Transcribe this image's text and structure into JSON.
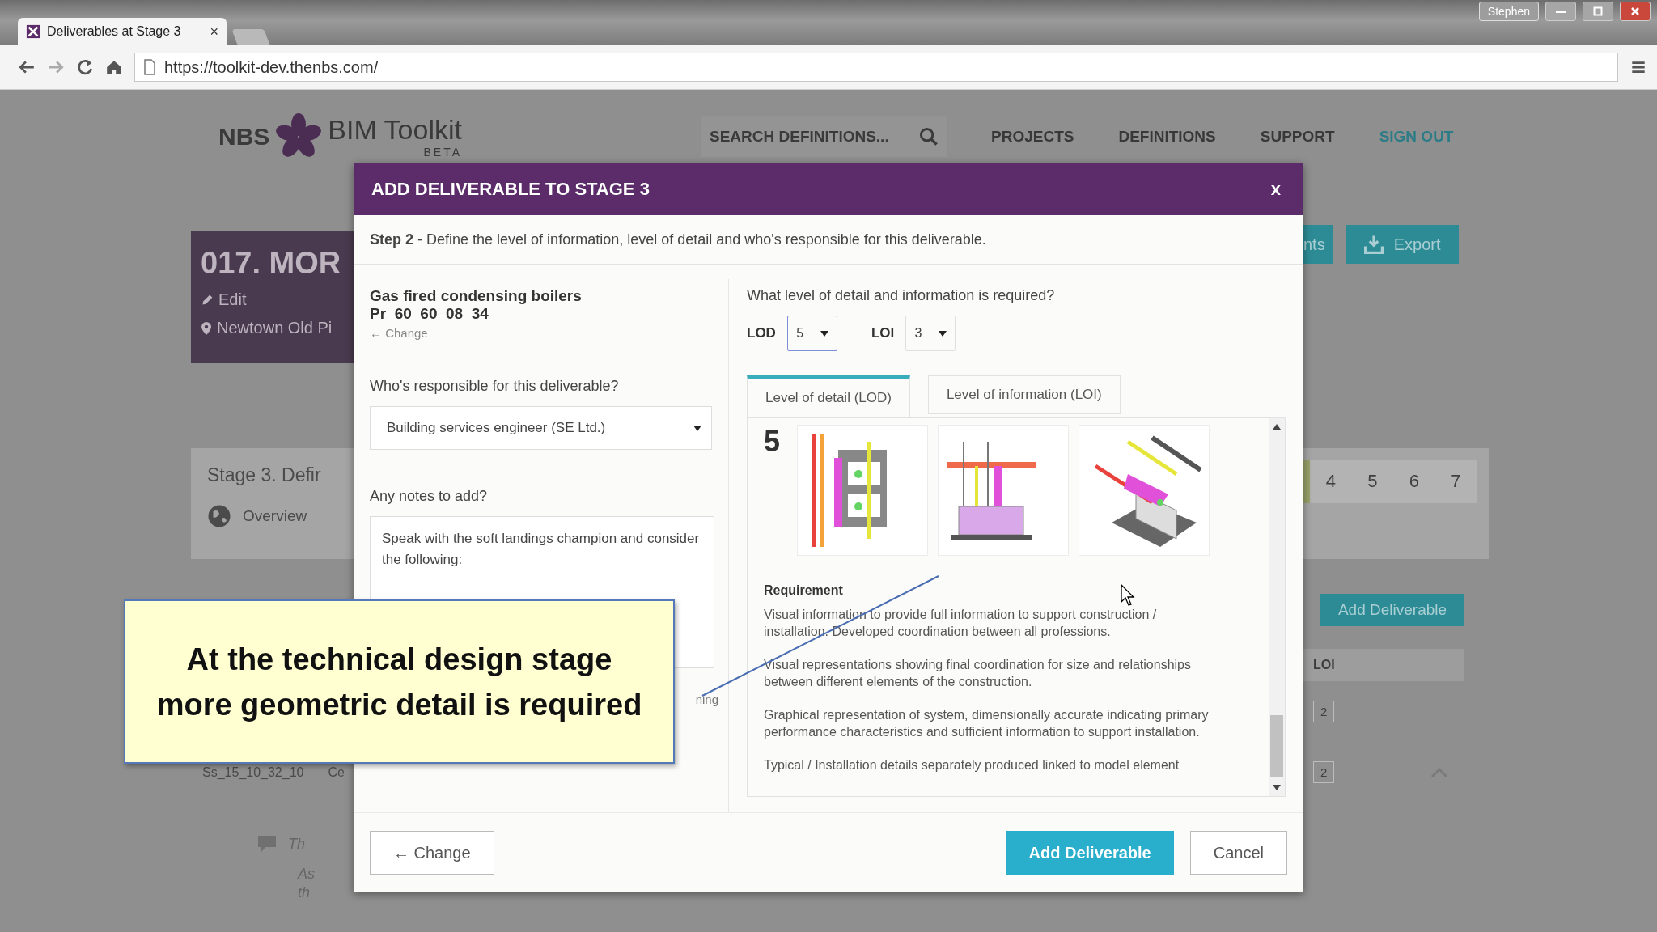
{
  "browser": {
    "tabs": [
      {
        "title": "Deliverables at Stage 3",
        "close": "×",
        "selected": true
      }
    ],
    "user": "Stephen",
    "address": "https://toolkit-dev.thenbs.com/"
  },
  "site": {
    "logo": {
      "brand": "NBS",
      "product": "BIM Toolkit",
      "badge": "BETA"
    },
    "search_placeholder": "SEARCH DEFINITIONS...",
    "nav": [
      {
        "label": "PROJECTS",
        "kind": "link"
      },
      {
        "label": "DEFINITIONS",
        "kind": "link"
      },
      {
        "label": "SUPPORT",
        "kind": "link"
      },
      {
        "label": "SIGN OUT",
        "kind": "accent"
      }
    ]
  },
  "project": {
    "title": "017. MOR",
    "edit": "Edit",
    "location": "Newtown Old Pi",
    "actions": [
      {
        "label": "nts",
        "kind": "plain"
      },
      {
        "label": "Export",
        "kind": "export"
      }
    ]
  },
  "stage": {
    "title": "Stage 3. Defir",
    "overview": "Overview",
    "steps": [
      "4",
      "5",
      "6",
      "7"
    ]
  },
  "deliverables": {
    "add_button": "Add Deliverable",
    "loi_column": "LOI",
    "rows": [
      {
        "loi": "2"
      },
      {
        "code": "Ss_15_10_32_10",
        "name": "Ce",
        "loi": "2",
        "expanded": true
      }
    ],
    "notes": [
      "Th",
      "As",
      "th"
    ]
  },
  "modal": {
    "title": "ADD DELIVERABLE TO STAGE 3",
    "close": "x",
    "step": "**Step 2** - Define the level of information, level of detail and who's responsible for this deliverable.",
    "product": {
      "name": "Gas fired condensing boilers",
      "code": "Pr_60_60_08_34",
      "change": "← Change"
    },
    "responsible": {
      "label": "Who's responsible for this deliverable?",
      "value": "Building services engineer (SE Ltd.)"
    },
    "notes": {
      "label": "Any notes to add?",
      "value": "Speak with the soft landings champion and consider the following:",
      "overflow": "ning"
    },
    "question": "What level of detail and information is required?",
    "selects": [
      {
        "label": "LOD",
        "value": "5",
        "focused": true
      },
      {
        "label": "LOI",
        "value": "3",
        "focused": false
      }
    ],
    "tabs": [
      {
        "label": "Level of detail (LOD)",
        "selected": true
      },
      {
        "label": "Level of information (LOI)",
        "selected": false
      }
    ],
    "level": "5",
    "diagrams": [
      {
        "kind": "side"
      },
      {
        "kind": "front"
      },
      {
        "kind": "isometric"
      }
    ],
    "requirement": {
      "heading": "Requirement",
      "paragraphs": [
        "Visual information to provide full information to support construction / installation. Developed coordination between all professions.",
        "Visual representations showing final coordination for size and relationships between different elements of the construction.",
        "Graphical representation of system, dimensionally accurate indicating primary performance characteristics and sufficient information to support installation.",
        "Typical / Installation details separately produced linked to model element"
      ]
    },
    "buttons": [
      {
        "label": "← Change",
        "kind": "back"
      },
      {
        "label": "Add Deliverable",
        "kind": "primary"
      },
      {
        "label": "Cancel",
        "kind": "secondary"
      }
    ]
  },
  "callout": {
    "text": "At the technical design stage\nmore geometric detail is required"
  }
}
